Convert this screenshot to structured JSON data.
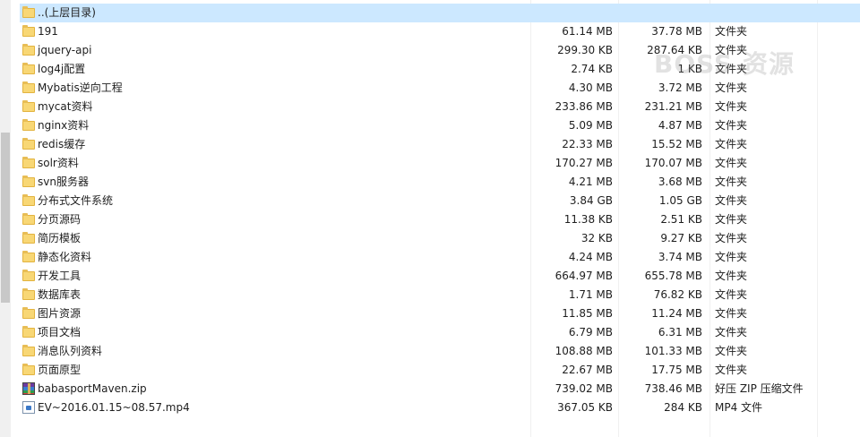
{
  "watermark": "BOSS 资源",
  "rows": [
    {
      "name": "..(上层目录)",
      "size": "",
      "packed": "",
      "type": "",
      "icon": "folder-icon",
      "selected": true
    },
    {
      "name": "191",
      "size": "61.14 MB",
      "packed": "37.78 MB",
      "type": "文件夹",
      "icon": "folder-icon"
    },
    {
      "name": "jquery-api",
      "size": "299.30 KB",
      "packed": "287.64 KB",
      "type": "文件夹",
      "icon": "folder-icon"
    },
    {
      "name": "log4j配置",
      "size": "2.74 KB",
      "packed": "1 KB",
      "type": "文件夹",
      "icon": "folder-icon"
    },
    {
      "name": "Mybatis逆向工程",
      "size": "4.30 MB",
      "packed": "3.72 MB",
      "type": "文件夹",
      "icon": "folder-icon"
    },
    {
      "name": "mycat资料",
      "size": "233.86 MB",
      "packed": "231.21 MB",
      "type": "文件夹",
      "icon": "folder-icon"
    },
    {
      "name": "nginx资料",
      "size": "5.09 MB",
      "packed": "4.87 MB",
      "type": "文件夹",
      "icon": "folder-icon"
    },
    {
      "name": "redis缓存",
      "size": "22.33 MB",
      "packed": "15.52 MB",
      "type": "文件夹",
      "icon": "folder-icon"
    },
    {
      "name": "solr资料",
      "size": "170.27 MB",
      "packed": "170.07 MB",
      "type": "文件夹",
      "icon": "folder-icon"
    },
    {
      "name": "svn服务器",
      "size": "4.21 MB",
      "packed": "3.68 MB",
      "type": "文件夹",
      "icon": "folder-icon"
    },
    {
      "name": "分布式文件系统",
      "size": "3.84 GB",
      "packed": "1.05 GB",
      "type": "文件夹",
      "icon": "folder-icon"
    },
    {
      "name": "分页源码",
      "size": "11.38 KB",
      "packed": "2.51 KB",
      "type": "文件夹",
      "icon": "folder-icon"
    },
    {
      "name": "简历模板",
      "size": "32 KB",
      "packed": "9.27 KB",
      "type": "文件夹",
      "icon": "folder-icon"
    },
    {
      "name": "静态化资料",
      "size": "4.24 MB",
      "packed": "3.74 MB",
      "type": "文件夹",
      "icon": "folder-icon"
    },
    {
      "name": "开发工具",
      "size": "664.97 MB",
      "packed": "655.78 MB",
      "type": "文件夹",
      "icon": "folder-icon"
    },
    {
      "name": "数据库表",
      "size": "1.71 MB",
      "packed": "76.82 KB",
      "type": "文件夹",
      "icon": "folder-icon"
    },
    {
      "name": "图片资源",
      "size": "11.85 MB",
      "packed": "11.24 MB",
      "type": "文件夹",
      "icon": "folder-icon"
    },
    {
      "name": "项目文档",
      "size": "6.79 MB",
      "packed": "6.31 MB",
      "type": "文件夹",
      "icon": "folder-icon"
    },
    {
      "name": "消息队列资料",
      "size": "108.88 MB",
      "packed": "101.33 MB",
      "type": "文件夹",
      "icon": "folder-icon"
    },
    {
      "name": "页面原型",
      "size": "22.67 MB",
      "packed": "17.75 MB",
      "type": "文件夹",
      "icon": "folder-icon"
    },
    {
      "name": "babasportMaven.zip",
      "size": "739.02 MB",
      "packed": "738.46 MB",
      "type": "好压 ZIP 压缩文件",
      "icon": "zip-icon"
    },
    {
      "name": "EV~2016.01.15~08.57.mp4",
      "size": "367.05 KB",
      "packed": "284 KB",
      "type": "MP4 文件",
      "icon": "video-icon"
    }
  ]
}
